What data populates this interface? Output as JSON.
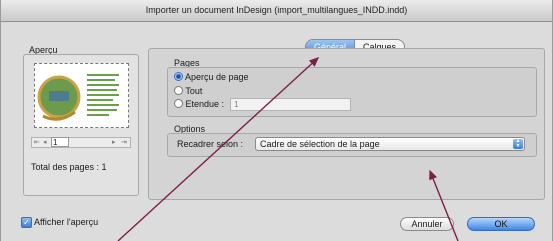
{
  "window": {
    "title": "Importer un document InDesign (import_multilangues_INDD.indd)"
  },
  "preview": {
    "label": "Aperçu",
    "page_field": "1",
    "total_pages_label": "Total des pages : 1",
    "show_preview_label": "Afficher l'aperçu"
  },
  "tabs": [
    {
      "label": "Général"
    },
    {
      "label": "Calques"
    }
  ],
  "pages": {
    "label": "Pages",
    "options": [
      {
        "label": "Aperçu de page"
      },
      {
        "label": "Tout"
      },
      {
        "label": "Etendue :"
      }
    ],
    "range_value": "1"
  },
  "options": {
    "label": "Options",
    "crop_label": "Recadrer selon :",
    "crop_value": "Cadre de sélection de la page"
  },
  "buttons": {
    "cancel": "Annuler",
    "ok": "OK"
  },
  "colors": {
    "accent": "#4a8ad9",
    "arrow": "#7a1f4a"
  },
  "icons": [
    "first-page-icon",
    "prev-page-icon",
    "next-page-icon",
    "last-page-icon",
    "checkbox-checked-icon",
    "select-arrow-icon"
  ]
}
